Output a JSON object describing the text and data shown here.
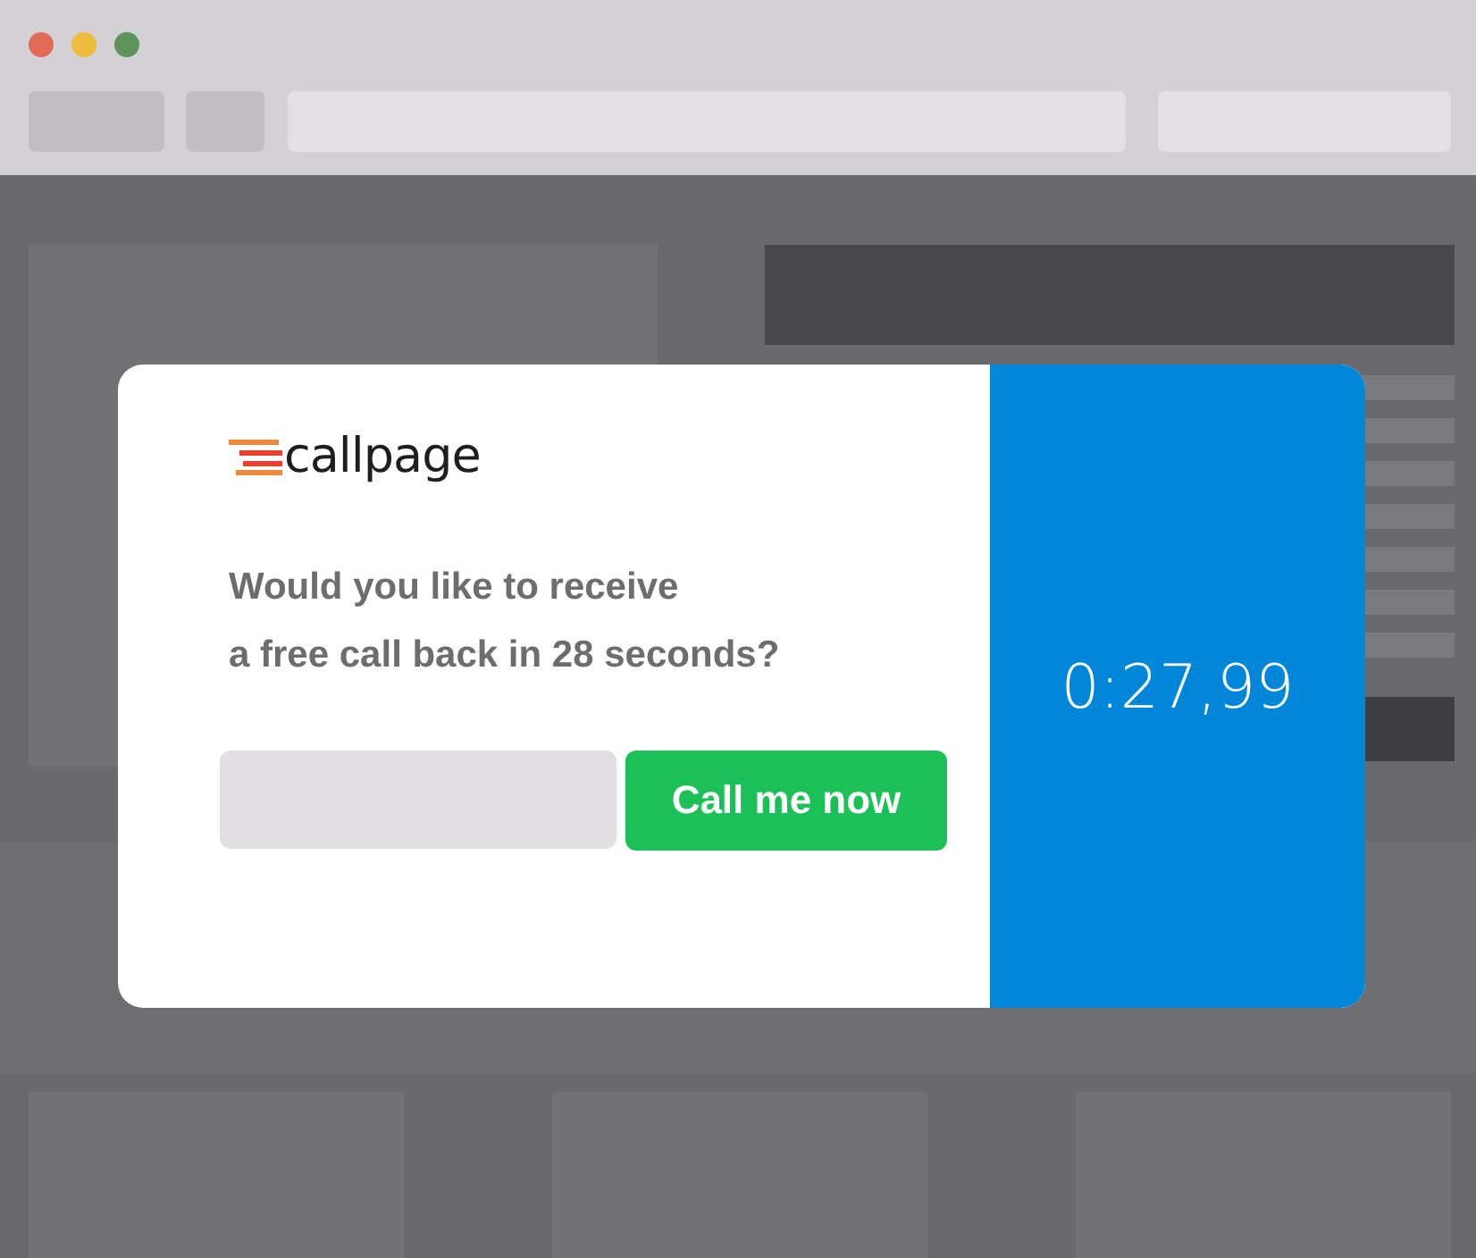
{
  "popup": {
    "logo": "callpage",
    "question_lines": [
      "Would you like to receive",
      "a free call back in 28 seconds?"
    ],
    "call_button": "Call me now",
    "timer": "0:27,99"
  }
}
